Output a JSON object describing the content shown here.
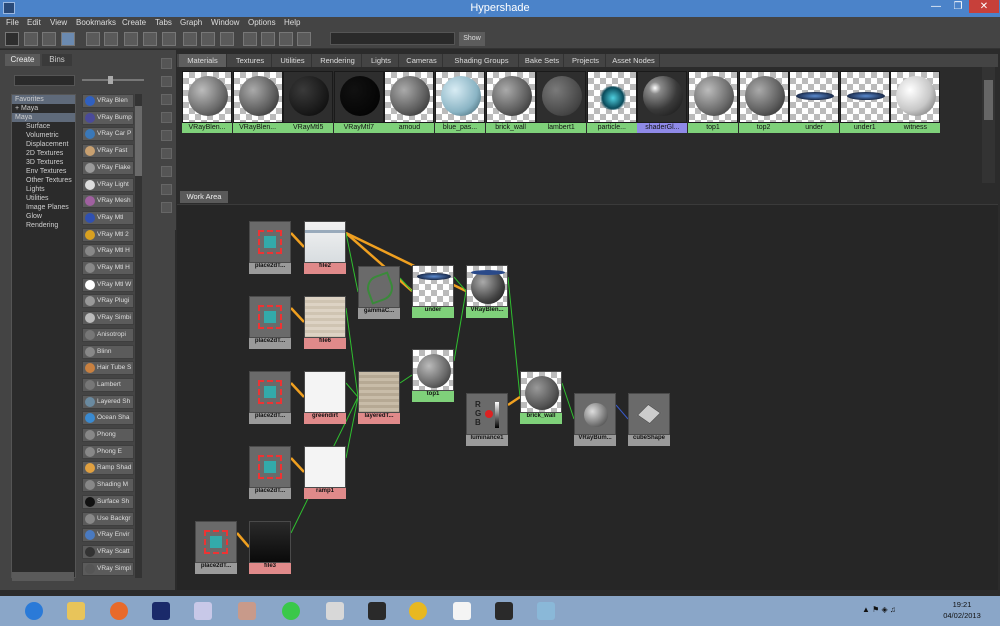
{
  "window": {
    "title": "Hypershade"
  },
  "menu": [
    "File",
    "Edit",
    "View",
    "Bookmarks",
    "Create",
    "Tabs",
    "Graph",
    "Window",
    "Options",
    "Help"
  ],
  "toolbar": {
    "show_label": "Show",
    "search_value": ""
  },
  "left_panel": {
    "tabs": [
      "Create",
      "Bins"
    ],
    "tree": [
      {
        "label": "Favorites",
        "selected": true
      },
      {
        "label": "+ Maya",
        "selected": false
      },
      {
        "label": "Maya",
        "selected": true
      },
      {
        "label": "Surface",
        "selected": false
      },
      {
        "label": "Volumetric",
        "selected": false
      },
      {
        "label": "Displacement",
        "selected": false
      },
      {
        "label": "2D Textures",
        "selected": false
      },
      {
        "label": "3D Textures",
        "selected": false
      },
      {
        "label": "Env Textures",
        "selected": false
      },
      {
        "label": "Other Textures",
        "selected": false
      },
      {
        "label": "Lights",
        "selected": false
      },
      {
        "label": "Utilities",
        "selected": false
      },
      {
        "label": "Image Planes",
        "selected": false
      },
      {
        "label": "Glow",
        "selected": false
      },
      {
        "label": "Rendering",
        "selected": false
      }
    ],
    "node_types": [
      "VRay Blen",
      "VRay Bump",
      "VRay Car P",
      "VRay Fast",
      "VRay Flake",
      "VRay Light",
      "VRay Mesh",
      "VRay Mtl",
      "VRay Mtl 2",
      "VRay Mtl H",
      "VRay Mtl H",
      "VRay Mtl W",
      "VRay Plugi",
      "VRay Simbi",
      "Anisotropi",
      "Blinn",
      "Hair Tube S",
      "Lambert",
      "Layered Sh",
      "Ocean Sha",
      "Phong",
      "Phong E",
      "Ramp Shad",
      "Shading M",
      "Surface Sh",
      "Use Backgr",
      "VRay Envir",
      "VRay Scatt",
      "VRay Simpl"
    ]
  },
  "tabs": [
    "Materials",
    "Textures",
    "Utilities",
    "Rendering",
    "Lights",
    "Cameras",
    "Shading Groups",
    "Bake Sets",
    "Projects",
    "Asset Nodes"
  ],
  "active_tab": "Materials",
  "materials": [
    {
      "label": "VRayBlen...",
      "style": "stone"
    },
    {
      "label": "VRayBlen...",
      "style": "brick"
    },
    {
      "label": "VRayMtl5",
      "style": "black-rough"
    },
    {
      "label": "VRayMtl7",
      "style": "black"
    },
    {
      "label": "amoud",
      "style": "brick"
    },
    {
      "label": "blue_pas...",
      "style": "blue"
    },
    {
      "label": "brick_wall",
      "style": "brick"
    },
    {
      "label": "lambert1",
      "style": "gray"
    },
    {
      "label": "particle...",
      "style": "particle"
    },
    {
      "label": "shaderGl...",
      "style": "glossy",
      "selected": true
    },
    {
      "label": "top1",
      "style": "stone"
    },
    {
      "label": "top2",
      "style": "brick"
    },
    {
      "label": "under",
      "style": "disc"
    },
    {
      "label": "under1",
      "style": "disc"
    },
    {
      "label": "witness",
      "style": "white"
    }
  ],
  "work_area": {
    "tab_label": "Work Area",
    "nodes": [
      {
        "id": "p1",
        "label": "place2dT...",
        "kind": "gray",
        "icon": "place2d"
      },
      {
        "id": "file2",
        "label": "file2",
        "kind": "red",
        "icon": "file-light"
      },
      {
        "id": "p2",
        "label": "place2dT...",
        "kind": "gray",
        "icon": "place2d"
      },
      {
        "id": "file6",
        "label": "file6",
        "kind": "red",
        "icon": "file-beige"
      },
      {
        "id": "gamma",
        "label": "gammaC...",
        "kind": "gray",
        "icon": "gamma"
      },
      {
        "id": "under",
        "label": "under",
        "kind": "green",
        "icon": "disc"
      },
      {
        "id": "vrayblen",
        "label": "VRayBlen...",
        "kind": "green",
        "icon": "sphere-disc"
      },
      {
        "id": "p3",
        "label": "place2dT...",
        "kind": "gray",
        "icon": "place2d"
      },
      {
        "id": "greendirt",
        "label": "greendirt",
        "kind": "red",
        "icon": "file-white"
      },
      {
        "id": "layered",
        "label": "layeredT...",
        "kind": "red",
        "icon": "file-tan"
      },
      {
        "id": "top1",
        "label": "top1",
        "kind": "green",
        "icon": "sphere-stone"
      },
      {
        "id": "lum",
        "label": "luminance1",
        "kind": "gray",
        "icon": "rgb"
      },
      {
        "id": "brick",
        "label": "brick_wall",
        "kind": "green",
        "icon": "sphere-brick"
      },
      {
        "id": "vraybump",
        "label": "VRayBum...",
        "kind": "gray",
        "icon": "vraybump"
      },
      {
        "id": "cube",
        "label": "cubeShape",
        "kind": "gray",
        "icon": "cube"
      },
      {
        "id": "p4",
        "label": "place2dT...",
        "kind": "gray",
        "icon": "place2d"
      },
      {
        "id": "ramp1",
        "label": "ramp1",
        "kind": "red",
        "icon": "file-white"
      },
      {
        "id": "p5",
        "label": "place2dT...",
        "kind": "gray",
        "icon": "place2d"
      },
      {
        "id": "file3",
        "label": "file3",
        "kind": "red",
        "icon": "file-dark"
      }
    ]
  },
  "taskbar": {
    "apps": [
      "internet-explorer",
      "file-explorer",
      "firefox",
      "photoshop",
      "app-purple",
      "app-face",
      "app-green",
      "maya",
      "nuke",
      "radiation",
      "7zip",
      "fc3",
      "app-window"
    ],
    "time": "19:21",
    "date": "04/02/2013"
  },
  "colors": {
    "title_bar": "#4b83c9",
    "label_green": "#7fd17a",
    "label_red": "#e08a8a",
    "wire_orange": "#f0a020",
    "wire_green": "#2fbf2f"
  }
}
